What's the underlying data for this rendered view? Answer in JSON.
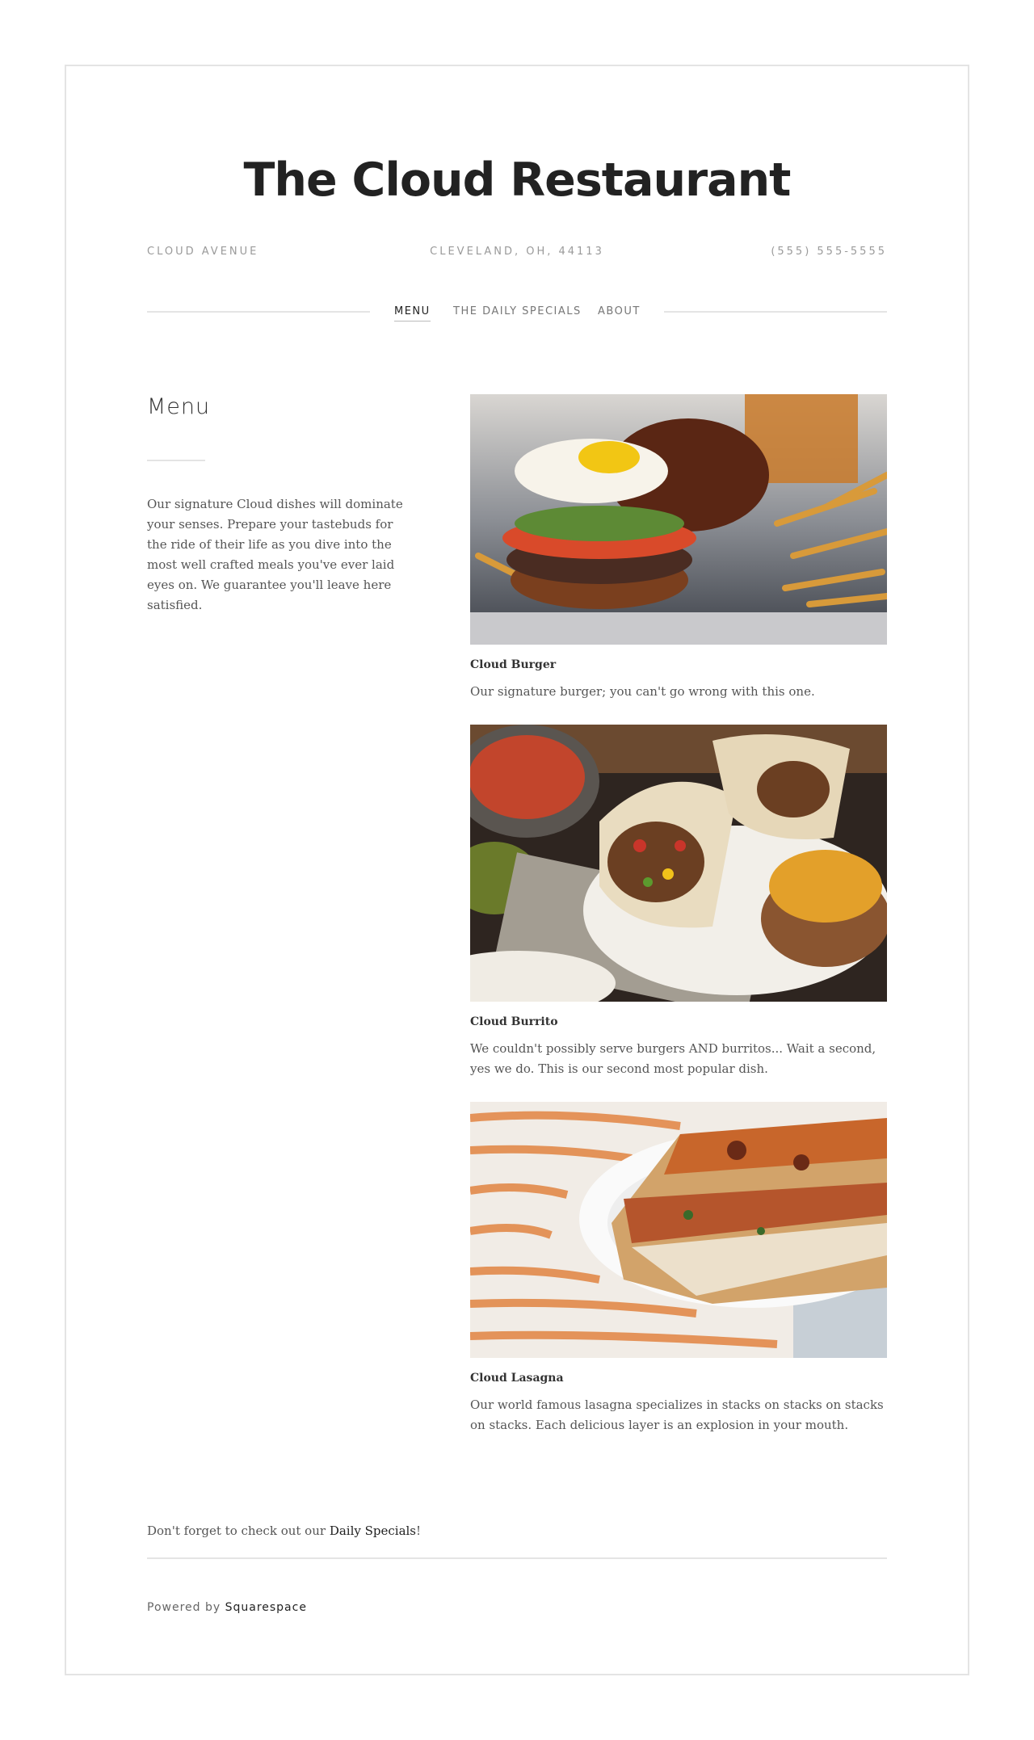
{
  "site": {
    "title": "The Cloud Restaurant",
    "address": "Cloud Avenue",
    "city": "Cleveland, OH, 44113",
    "phone": "(555) 555-5555"
  },
  "nav": {
    "items": [
      "MENU",
      "THE DAILY SPECIALS",
      "ABOUT"
    ],
    "active": "MENU"
  },
  "page": {
    "heading": "Menu",
    "intro": "Our signature Cloud dishes will dominate your senses. Prepare your tastebuds for the ride of their life as you dive into the most well crafted meals you've ever laid eyes on. We guarantee you'll leave here satisfied."
  },
  "dishes": [
    {
      "name": "Cloud Burger",
      "description": "Our signature burger; you can't go wrong with this one."
    },
    {
      "name": "Cloud Burrito",
      "description": "We couldn't possibly serve burgers AND burritos... Wait a second, yes we do. This is our second most popular dish."
    },
    {
      "name": "Cloud Lasagna",
      "description": "Our world famous lasagna specializes in stacks on stacks on stacks on stacks. Each delicious layer is an explosion in your mouth."
    }
  ],
  "footer": {
    "note_prefix": "Don't forget to check out our ",
    "note_link": "Daily Specials",
    "note_suffix": "!",
    "powered_prefix": "Powered by ",
    "powered_link": "Squarespace"
  }
}
